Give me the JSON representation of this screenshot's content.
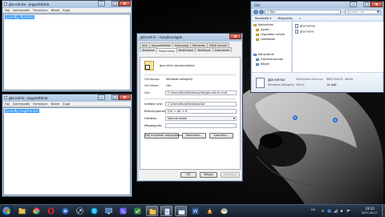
{
  "notepad_top": {
    "title": "gta-net-ba - Jegyzettömb",
    "menu": [
      "Fájl",
      "Szerkesztés",
      "Formátum",
      "Nézet",
      "Súgó"
    ],
    "selected_text": "ipconfig /flushdns"
  },
  "notepad_bottom": {
    "title": "gta-net-ki - Jegyzettömb",
    "menu": [
      "Fájl",
      "Szerkesztés",
      "Formátum",
      "Nézet",
      "Súgó"
    ],
    "selected_text": "ipconfig /registerdns"
  },
  "properties": {
    "title": "gta-net-ki – tulajdonságok",
    "tabs_row1": [
      "Szín",
      "Kompatibilitás",
      "Biztonság",
      "Részletek",
      "Előző verziók"
    ],
    "tabs_row2": [
      "Általános",
      "Parancsikon",
      "Beállítások",
      "Betűtípus",
      "Elrendezés"
    ],
    "active_tab": "Parancsikon",
    "shortcut_name": "gta-net-ki parancsikonja",
    "fields": {
      "target_type_label": "Cél típusa:",
      "target_type_value": "Windows kötegfájl",
      "target_location_label": "Cél helye:",
      "target_location_value": "Gta",
      "target_label": "Cél:",
      "target_value": "C:\\Users\\Bus\\Desktop\\Gta\\gta-net-ki.cmd",
      "start_in_label": "Indítási hely:",
      "start_in_value": "C:\\Users\\Bus\\Desktop\\Gta",
      "shortcut_key_label": "Billentyűparancs:",
      "shortcut_key_value": "Ctrl + Alt + K",
      "run_label": "Futtatás:",
      "run_value": "Normál ablak",
      "comment_label": "Megjegyzés:",
      "comment_value": ""
    },
    "buttons": {
      "open_location": "Fájl helyének megnyitása",
      "change_icon": "Ikoncsere...",
      "advanced": "Speciális..."
    },
    "footer": {
      "ok": "OK",
      "cancel": "Mégse",
      "apply": "Alkalmaz"
    }
  },
  "explorer": {
    "title": "Gta",
    "address": "« Gta",
    "search_placeholder": "Keresés: Gta",
    "commands": [
      "Rendezés ▾",
      "Megnyitás",
      "»"
    ],
    "nav": {
      "favorites_header": "Kedvencek",
      "favorites": [
        "Asztal",
        "Legutóbbi helyek",
        "Letöltések"
      ],
      "libraries_header": "Könyvtárak",
      "libraries": [
        "Dokumentumok",
        "Képek"
      ]
    },
    "files": [
      "gta-net-ba",
      "gta-net-ki"
    ],
    "details": {
      "name": "gta-net-ba",
      "type": "Windows kötegfájl",
      "modified_label": "Módosítás dátuma:",
      "modified_value": "2017.04.17. 19:01",
      "size_label": "Méret:",
      "size_value": "14 bájt"
    }
  },
  "taskbar": {
    "language": "HU",
    "time": "19:10",
    "date": "2017.04.17."
  },
  "colors": {
    "window_frame": "#b9d1ea",
    "selection": "#3399ff",
    "taskbar": "#1c2838",
    "close_button": "#c6432f"
  }
}
